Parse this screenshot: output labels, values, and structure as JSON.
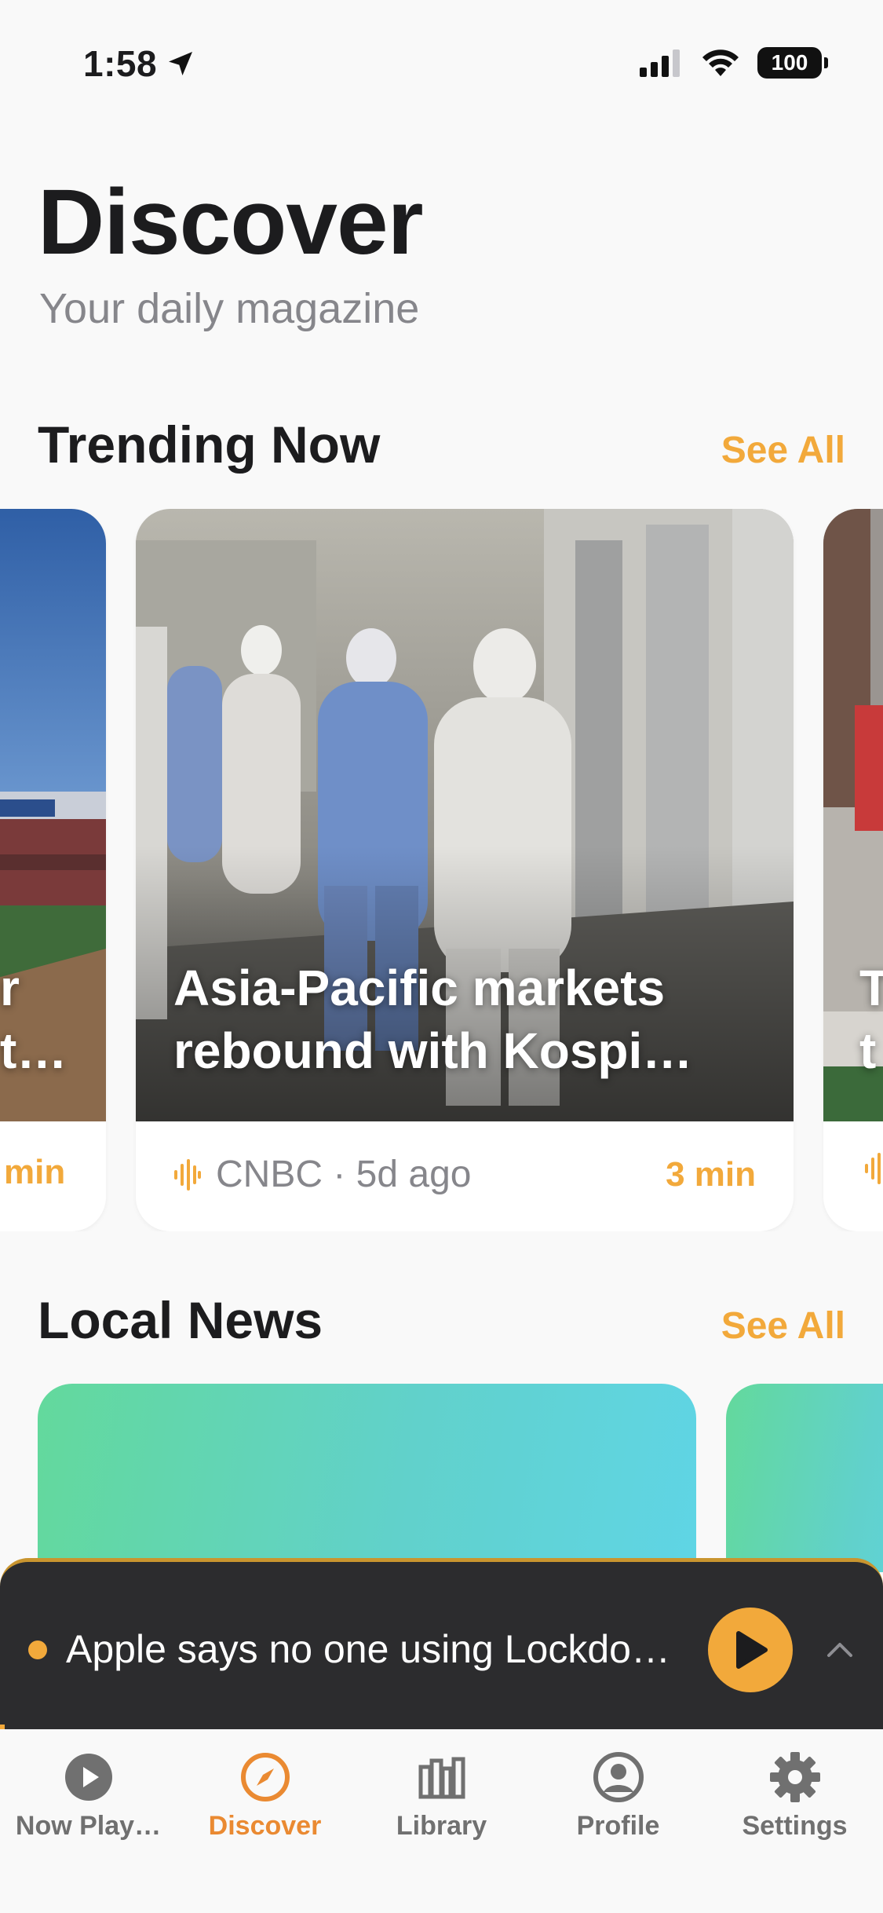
{
  "status_bar": {
    "time": "1:58",
    "battery": "100",
    "icons": [
      "location-arrow-icon",
      "cellular-signal-icon",
      "wifi-icon",
      "battery-icon"
    ]
  },
  "header": {
    "title": "Discover",
    "subtitle": "Your daily magazine"
  },
  "trending": {
    "title": "Trending Now",
    "see_all": "See All",
    "cards": [
      {
        "caption_line1": "r",
        "caption_line2": "t…",
        "read_time": "min"
      },
      {
        "caption_line1": "Asia-Pacific markets",
        "caption_line2": "rebound with Kospi…",
        "source": "CNBC · 5d ago",
        "read_time": "3 min"
      },
      {
        "caption_line1": "T",
        "caption_line2": "t"
      }
    ]
  },
  "local_news": {
    "title": "Local News",
    "see_all": "See All"
  },
  "mini_player": {
    "title": "Apple says no one using Lockdo…"
  },
  "tab_bar": {
    "tabs": [
      {
        "label": "Now Play…",
        "icon": "play-circle-icon",
        "active": false
      },
      {
        "label": "Discover",
        "icon": "compass-icon",
        "active": true
      },
      {
        "label": "Library",
        "icon": "library-books-icon",
        "active": false
      },
      {
        "label": "Profile",
        "icon": "person-circle-icon",
        "active": false
      },
      {
        "label": "Settings",
        "icon": "gear-icon",
        "active": false
      }
    ]
  },
  "colors": {
    "accent": "#f2a93b",
    "active_tab": "#ea8a32",
    "mini_player_bg": "#2c2c2e"
  }
}
